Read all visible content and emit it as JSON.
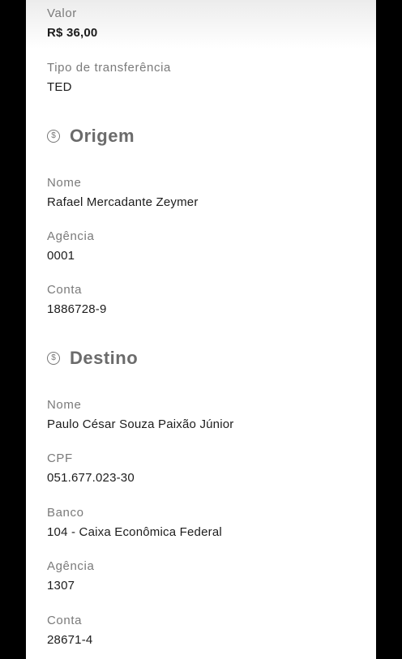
{
  "summary": {
    "valor_label": "Valor",
    "valor_value": "R$ 36,00",
    "tipo_label": "Tipo de transferência",
    "tipo_value": "TED"
  },
  "origem": {
    "title": "Origem",
    "icon": "dollar-coin-icon",
    "nome_label": "Nome",
    "nome_value": "Rafael Mercadante Zeymer",
    "agencia_label": "Agência",
    "agencia_value": "0001",
    "conta_label": "Conta",
    "conta_value": "1886728-9"
  },
  "destino": {
    "title": "Destino",
    "icon": "dollar-coin-icon",
    "nome_label": "Nome",
    "nome_value": "Paulo César Souza Paixão Júnior",
    "cpf_label": "CPF",
    "cpf_value": "051.677.023-30",
    "banco_label": "Banco",
    "banco_value": "104 - Caixa Econômica Federal",
    "agencia_label": "Agência",
    "agencia_value": "1307",
    "conta_label": "Conta",
    "conta_value": "28671-4"
  },
  "colors": {
    "background": "#000000",
    "card": "#ffffff",
    "label": "#7a7a7a",
    "value": "#1c1c1c",
    "section_title": "#6b6b6b"
  }
}
